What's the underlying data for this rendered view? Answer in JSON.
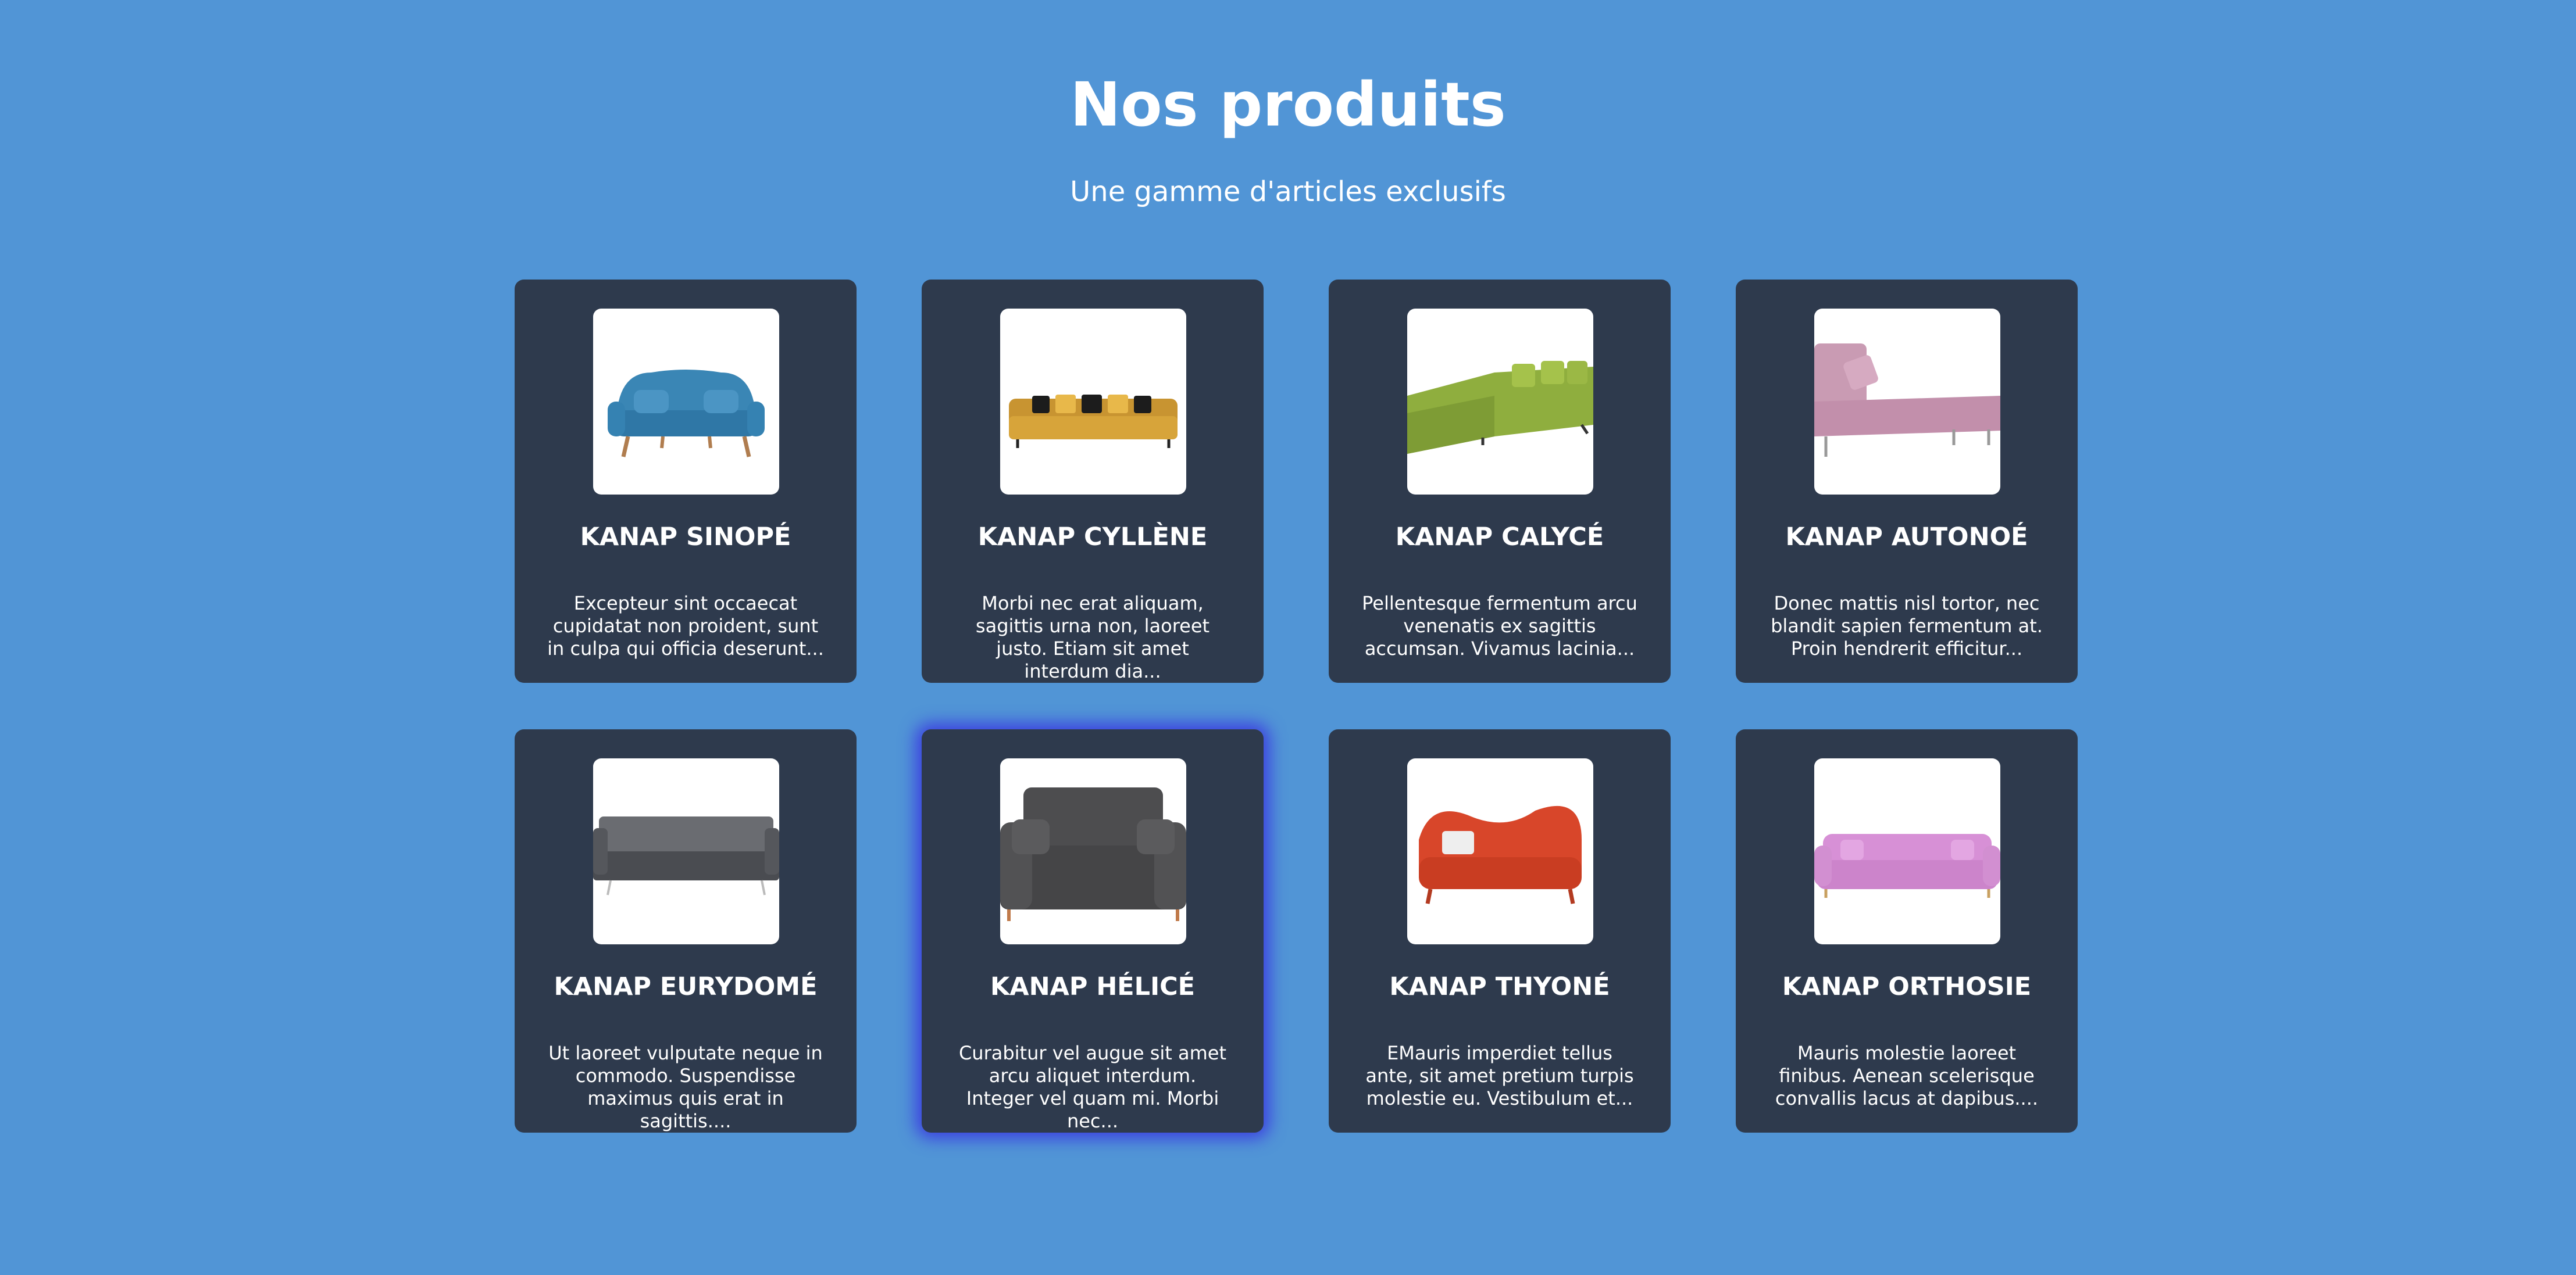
{
  "header": {
    "title": "Nos produits",
    "subtitle": "Une gamme d'articles exclusifs"
  },
  "colors": {
    "background": "#5195d6",
    "card": "#2e3a4d",
    "highlight_glow": "#3c3fe0"
  },
  "products": [
    {
      "name": "KANAP SINOPÉ",
      "description": "Excepteur sint occaecat cupidatat non proident, sunt in culpa qui officia deserunt...",
      "image_icon": "blue-sofa-image",
      "color": "#3a86b5"
    },
    {
      "name": "KANAP CYLLÈNE",
      "description": "Morbi nec erat aliquam, sagittis urna non, laoreet justo. Etiam sit amet interdum dia...",
      "image_icon": "yellow-sofa-image",
      "color": "#d7a43a"
    },
    {
      "name": "KANAP CALYCÉ",
      "description": "Pellentesque fermentum arcu venenatis ex sagittis accumsan. Vivamus lacinia...",
      "image_icon": "green-corner-sofa-image",
      "color": "#8fae3e"
    },
    {
      "name": "KANAP AUTONOÉ",
      "description": "Donec mattis nisl tortor, nec blandit sapien fermentum at. Proin hendrerit efficitur...",
      "image_icon": "pink-chaise-sofa-image",
      "color": "#c99bb3"
    },
    {
      "name": "KANAP EURYDOMÉ",
      "description": "Ut laoreet vulputate neque in commodo. Suspendisse maximus quis erat in sagittis....",
      "image_icon": "gray-sofa-image",
      "color": "#55575c"
    },
    {
      "name": "KANAP HÉLICÉ",
      "description": "Curabitur vel augue sit amet arcu aliquet interdum. Integer vel quam mi. Morbi nec...",
      "image_icon": "dark-gray-sofa-image",
      "color": "#4d4d4f",
      "highlighted": true
    },
    {
      "name": "KANAP THYONÉ",
      "description": "EMauris imperdiet tellus ante, sit amet pretium turpis molestie eu. Vestibulum et...",
      "image_icon": "red-sofa-image",
      "color": "#d8462a"
    },
    {
      "name": "KANAP ORTHOSIE",
      "description": "Mauris molestie laoreet finibus. Aenean scelerisque convallis lacus at dapibus....",
      "image_icon": "pink-chesterfield-sofa-image",
      "color": "#d790d6"
    }
  ]
}
